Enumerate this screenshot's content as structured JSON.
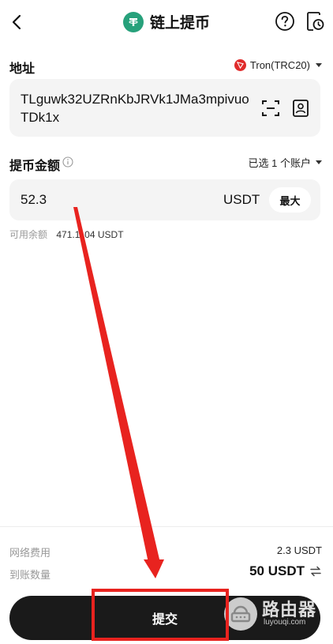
{
  "header": {
    "title": "链上提币",
    "coin_logo": "T",
    "icons": {
      "back": "chevron-left-icon",
      "help": "question-circle-icon",
      "history": "history-icon"
    }
  },
  "address": {
    "label": "地址",
    "network": "Tron(TRC20)",
    "value": "TLguwk32UZRnKbJRVk1JMa3mpivuoTDk1x",
    "icons": {
      "scan": "scan-icon",
      "contacts": "contact-book-icon"
    }
  },
  "amount": {
    "label": "提币金额",
    "account_selector": "已选 1 个账户",
    "value": "52.3",
    "unit": "USDT",
    "max_label": "最大",
    "balance_label": "可用余额",
    "balance_value": "471.1104 USDT"
  },
  "fees": {
    "network_fee_label": "网络费用",
    "network_fee_value": "2.3 USDT",
    "arrive_label": "到账数量",
    "arrive_value": "50 USDT"
  },
  "submit_label": "提交",
  "watermark": {
    "name": "路由器",
    "url": "luyouqi.com"
  },
  "colors": {
    "tether_green": "#27a17b",
    "tron_red": "#e02b2b",
    "highlight_red": "#e8231f",
    "button_dark": "#1a1a1a"
  }
}
